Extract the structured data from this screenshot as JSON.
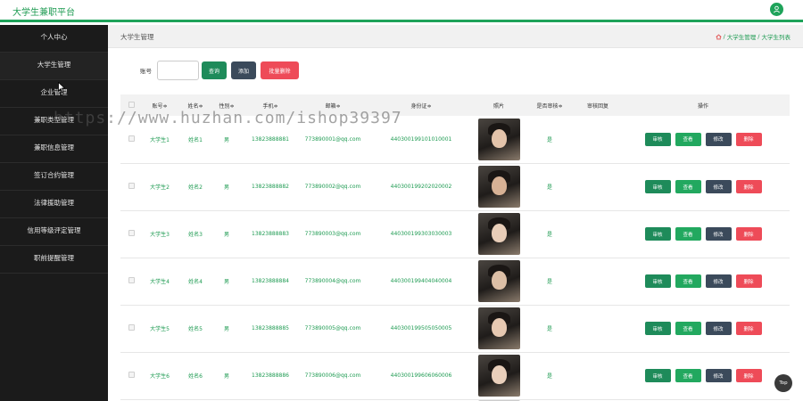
{
  "app": {
    "title": "大学生兼职平台",
    "avatar_icon": "user-icon",
    "accent": "#1ea35a"
  },
  "sidebar": {
    "items": [
      {
        "label": "个人中心"
      },
      {
        "label": "大学生管理"
      },
      {
        "label": "企业管理"
      },
      {
        "label": "兼职类型管理"
      },
      {
        "label": "兼职信息管理"
      },
      {
        "label": "签订合约管理"
      },
      {
        "label": "法律援助管理"
      },
      {
        "label": "信用等级评定管理"
      },
      {
        "label": "职前提醒管理"
      }
    ]
  },
  "page": {
    "title": "大学生管理",
    "breadcrumb": {
      "home_icon": "home-icon",
      "sep": "/",
      "level1": "大学生管理",
      "level2": "大学生列表"
    }
  },
  "search": {
    "label": "账号",
    "value": "",
    "placeholder": "",
    "search_btn": "查询",
    "add_btn": "添加",
    "batch_delete_btn": "批量删除"
  },
  "table": {
    "headers": {
      "account": "账号≑",
      "name": "姓名≑",
      "gender": "性别≑",
      "phone": "手机≑",
      "email": "邮箱≑",
      "idcard": "身份证≑",
      "photo": "照片",
      "approved": "是否审核≑",
      "reply": "审核回复",
      "ops": "操作"
    },
    "rows": [
      {
        "account": "大学生1",
        "name": "姓名1",
        "gender": "男",
        "phone": "13823888881",
        "email": "773890001@qq.com",
        "idcard": "440300199101010001",
        "approved": "是",
        "reply": ""
      },
      {
        "account": "大学生2",
        "name": "姓名2",
        "gender": "男",
        "phone": "13823888882",
        "email": "773890002@qq.com",
        "idcard": "440300199202020002",
        "approved": "是",
        "reply": ""
      },
      {
        "account": "大学生3",
        "name": "姓名3",
        "gender": "男",
        "phone": "13823888883",
        "email": "773890003@qq.com",
        "idcard": "440300199303030003",
        "approved": "是",
        "reply": ""
      },
      {
        "account": "大学生4",
        "name": "姓名4",
        "gender": "男",
        "phone": "13823888884",
        "email": "773890004@qq.com",
        "idcard": "440300199404040004",
        "approved": "是",
        "reply": ""
      },
      {
        "account": "大学生5",
        "name": "姓名5",
        "gender": "男",
        "phone": "13823888885",
        "email": "773890005@qq.com",
        "idcard": "440300199505050005",
        "approved": "是",
        "reply": ""
      },
      {
        "account": "大学生6",
        "name": "姓名6",
        "gender": "男",
        "phone": "13823888886",
        "email": "773890006@qq.com",
        "idcard": "440300199606060006",
        "approved": "是",
        "reply": ""
      }
    ],
    "row_actions": {
      "audit": "审核",
      "view": "查看",
      "edit": "修改",
      "delete": "删除"
    }
  },
  "watermark": "https://www.huzhan.com/ishop39397",
  "back_to_top": "Top"
}
